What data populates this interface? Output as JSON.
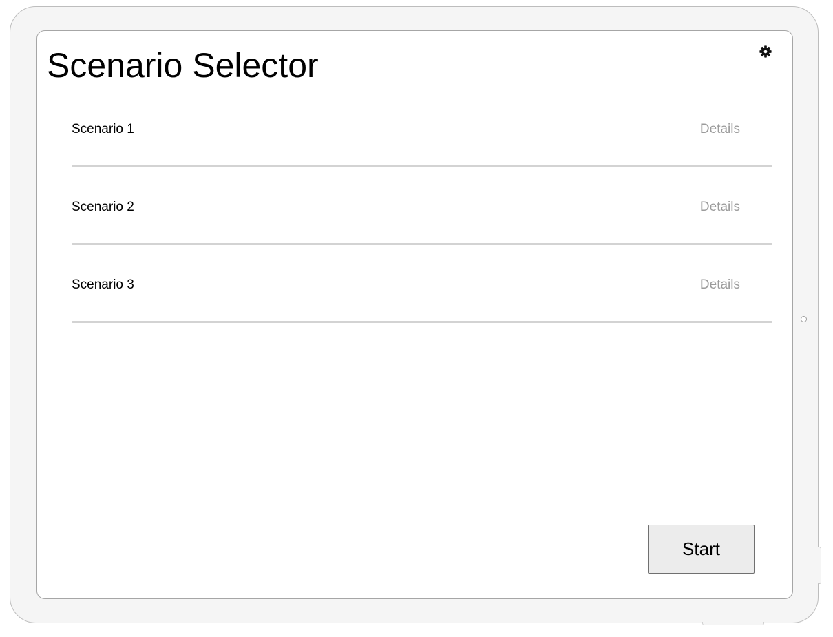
{
  "header": {
    "title": "Scenario Selector",
    "settings_icon": "gear-icon"
  },
  "scenarios": [
    {
      "name": "Scenario 1",
      "details_label": "Details"
    },
    {
      "name": "Scenario 2",
      "details_label": "Details"
    },
    {
      "name": "Scenario 3",
      "details_label": "Details"
    }
  ],
  "footer": {
    "start_label": "Start"
  }
}
